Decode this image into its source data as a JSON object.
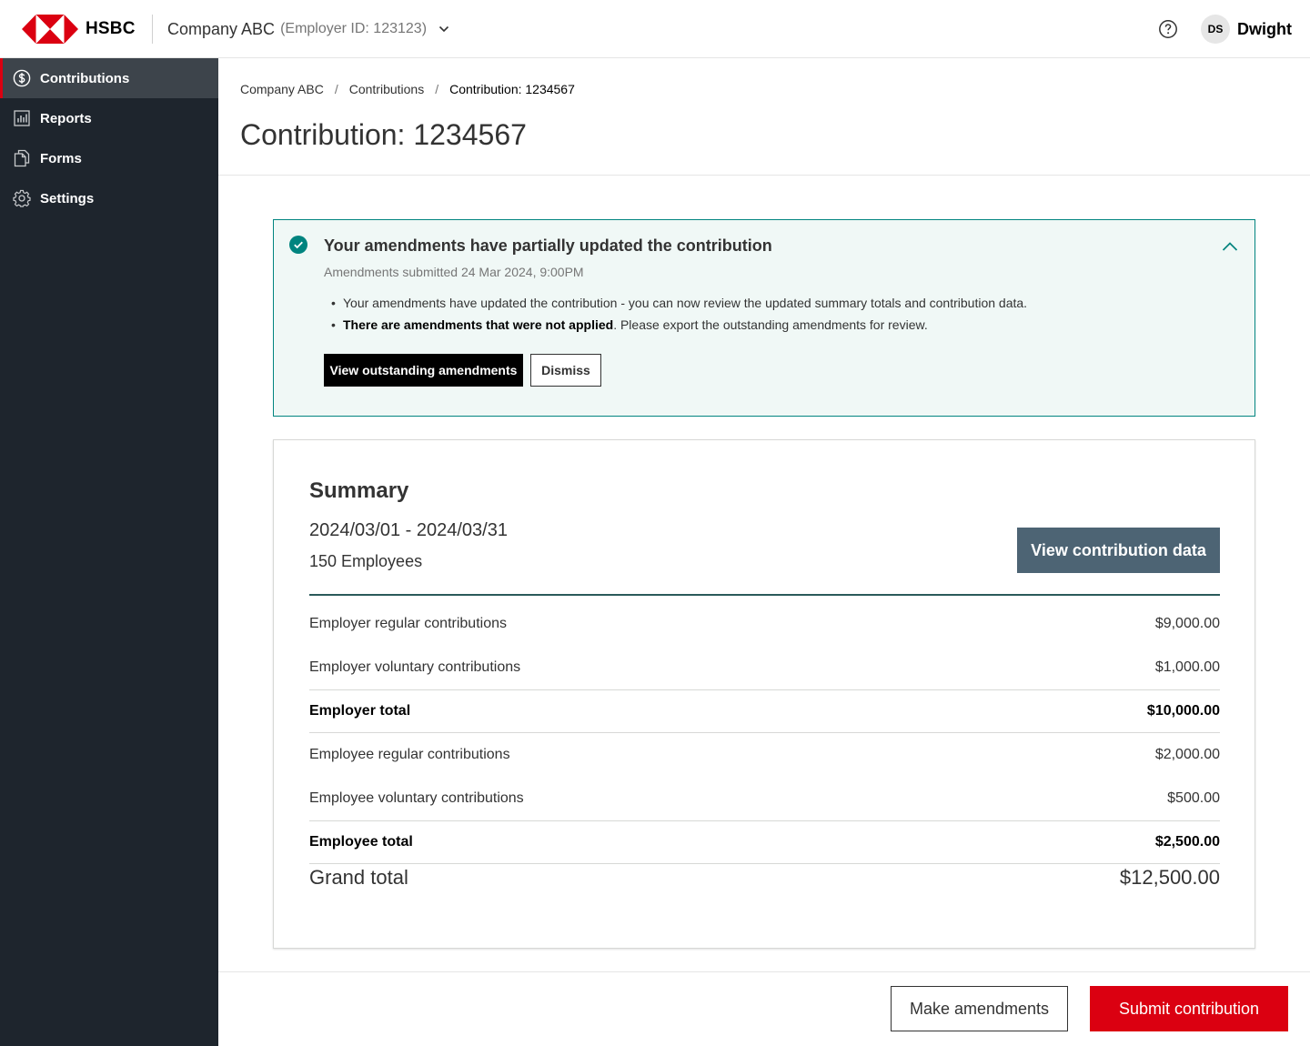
{
  "brand": {
    "name": "HSBC",
    "logo_icon": "hsbc-hexagon-logo",
    "accent": "#db0011"
  },
  "header": {
    "company_name": "Company ABC",
    "employer_id": "(Employer ID: 123123)",
    "user_initials": "DS",
    "user_name": "Dwight"
  },
  "sidebar": {
    "items": [
      {
        "label": "Contributions",
        "icon": "dollar-circle-icon",
        "active": true
      },
      {
        "label": "Reports",
        "icon": "bar-chart-icon",
        "active": false
      },
      {
        "label": "Forms",
        "icon": "documents-icon",
        "active": false
      },
      {
        "label": "Settings",
        "icon": "gear-icon",
        "active": false
      }
    ]
  },
  "breadcrumb": [
    "Company ABC",
    "Contributions",
    "Contribution: 1234567"
  ],
  "page_title": "Contribution: 1234567",
  "notice": {
    "title": "Your amendments have partially updated the contribution",
    "subtitle": "Amendments submitted 24 Mar 2024, 9:00PM",
    "bullet_1": "Your amendments have updated the contribution - you can now review the updated summary totals and contribution data.",
    "bullet_2_bold": "There are amendments that were not applied",
    "bullet_2_rest": ". Please export the outstanding amendments for review.",
    "primary_button": "View outstanding amendments",
    "secondary_button": "Dismiss",
    "status_color": "#00847f"
  },
  "summary": {
    "title": "Summary",
    "period": "2024/03/01 - 2024/03/31",
    "employees": "150 Employees",
    "view_button": "View contribution data",
    "rows": [
      {
        "label": "Employer regular contributions",
        "amount": "$9,000.00",
        "is_total": false
      },
      {
        "label": "Employer voluntary contributions",
        "amount": "$1,000.00",
        "is_total": false
      },
      {
        "label": "Employer total",
        "amount": "$10,000.00",
        "is_total": true
      },
      {
        "label": "Employee regular contributions",
        "amount": "$2,000.00",
        "is_total": false
      },
      {
        "label": "Employee voluntary contributions",
        "amount": "$500.00",
        "is_total": false
      },
      {
        "label": "Employee total",
        "amount": "$2,500.00",
        "is_total": true
      }
    ],
    "grand_total_label": "Grand total",
    "grand_total_amount": "$12,500.00"
  },
  "footer": {
    "amend_button": "Make amendments",
    "submit_button": "Submit contribution"
  }
}
